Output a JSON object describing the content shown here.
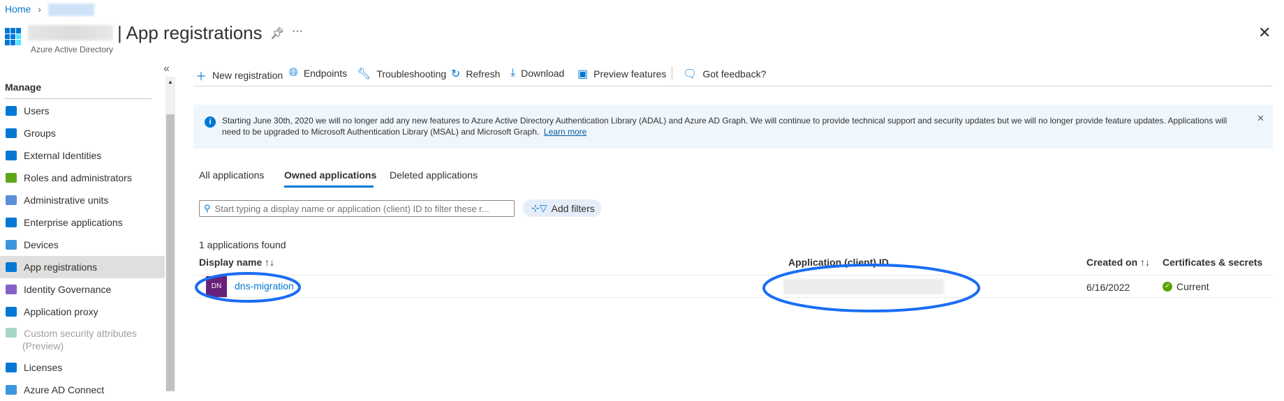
{
  "breadcrumb": {
    "home": "Home"
  },
  "header": {
    "title": "| App registrations",
    "subtitle": "Azure Active Directory",
    "more": "···"
  },
  "sidebar": {
    "collapse": "«",
    "section": "Manage",
    "items": [
      {
        "label": "Users",
        "color": "#0078d4"
      },
      {
        "label": "Groups",
        "color": "#0078d4"
      },
      {
        "label": "External Identities",
        "color": "#0078d4"
      },
      {
        "label": "Roles and administrators",
        "color": "#5ea51c"
      },
      {
        "label": "Administrative units",
        "color": "#5a8fd6"
      },
      {
        "label": "Enterprise applications",
        "color": "#0078d4"
      },
      {
        "label": "Devices",
        "color": "#3a96dd"
      },
      {
        "label": "App registrations",
        "color": "#0078d4"
      },
      {
        "label": "Identity Governance",
        "color": "#8661c5"
      },
      {
        "label": "Application proxy",
        "color": "#0078d4"
      },
      {
        "label": "Custom security attributes",
        "label2": "(Preview)",
        "color": "#a8d5c8"
      },
      {
        "label": "Licenses",
        "color": "#0078d4"
      },
      {
        "label": "Azure AD Connect",
        "color": "#3a96dd"
      }
    ]
  },
  "toolbar": {
    "new": "New registration",
    "endpoints": "Endpoints",
    "troubleshooting": "Troubleshooting",
    "refresh": "Refresh",
    "download": "Download",
    "preview": "Preview features",
    "feedback": "Got feedback?"
  },
  "banner": {
    "text": "Starting June 30th, 2020 we will no longer add any new features to Azure Active Directory Authentication Library (ADAL) and Azure AD Graph. We will continue to provide technical support and security updates but we will no longer provide feature updates. Applications will need to be upgraded to Microsoft Authentication Library (MSAL) and Microsoft Graph.",
    "link": "Learn more"
  },
  "tabs": [
    "All applications",
    "Owned applications",
    "Deleted applications"
  ],
  "search": {
    "placeholder": "Start typing a display name or application (client) ID to filter these r..."
  },
  "add_filters": "Add filters",
  "count": "1 applications found",
  "table": {
    "headers": [
      "Display name ↑↓",
      "Application (client) ID",
      "Created on ↑↓",
      "Certificates & secrets"
    ],
    "rows": [
      {
        "initials": "DN",
        "name": "dns-migration",
        "created": "6/16/2022",
        "certs": "Current"
      }
    ]
  },
  "colors": {
    "accent": "#0078d4",
    "annotation": "#1a6cf5",
    "avatar": "#68217a",
    "ok": "#57a300"
  }
}
